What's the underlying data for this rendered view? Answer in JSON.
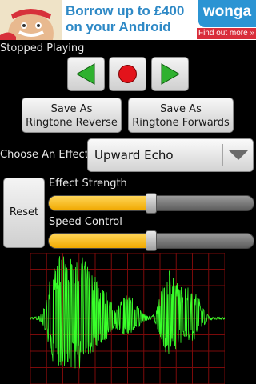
{
  "ad": {
    "headline_line1": "Borrow up to £400",
    "headline_line2": "on your Android",
    "brand": "wonga",
    "cta": "Find out more »"
  },
  "player": {
    "status": "Stopped Playing",
    "back_icon": "green-left-arrow",
    "record_icon": "red-record-dot",
    "play_icon": "green-right-arrow"
  },
  "save": {
    "reverse_line1": "Save As",
    "reverse_line2": "Ringtone Reverse",
    "forward_line1": "Save As",
    "forward_line2": "Ringtone Forwards"
  },
  "effect": {
    "label": "Choose An Effect",
    "selected": "Upward Echo"
  },
  "controls": {
    "reset_label": "Reset",
    "effect_strength_label": "Effect Strength",
    "effect_strength_value": 0.5,
    "speed_control_label": "Speed Control",
    "speed_control_value": 0.5
  },
  "waveform": {
    "grid_color": "#7a0a0a",
    "wave_color": "#39ff2a"
  },
  "colors": {
    "accent_green": "#2fb12f",
    "record_red": "#e3131b",
    "slider_fill": "#f5b400"
  }
}
